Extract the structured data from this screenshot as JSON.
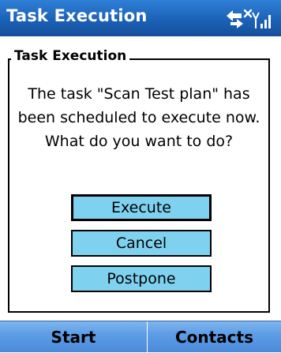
{
  "titlebar": {
    "title": "Task Execution",
    "icons": [
      "connectivity-icon",
      "signal-strength-icon"
    ]
  },
  "dialog": {
    "group_label": "Task Execution",
    "message": "The task \"Scan Test plan\" has been scheduled to execute now. What do you want to do?",
    "buttons": {
      "execute": "Execute",
      "cancel": "Cancel",
      "postpone": "Postpone"
    },
    "focused_button": "execute"
  },
  "softkeys": {
    "left": "Start",
    "right": "Contacts"
  },
  "colors": {
    "titlebar": "#1a5fb4",
    "button_fill": "#7fd2ef",
    "softkey_bar": "#5e9de6"
  }
}
